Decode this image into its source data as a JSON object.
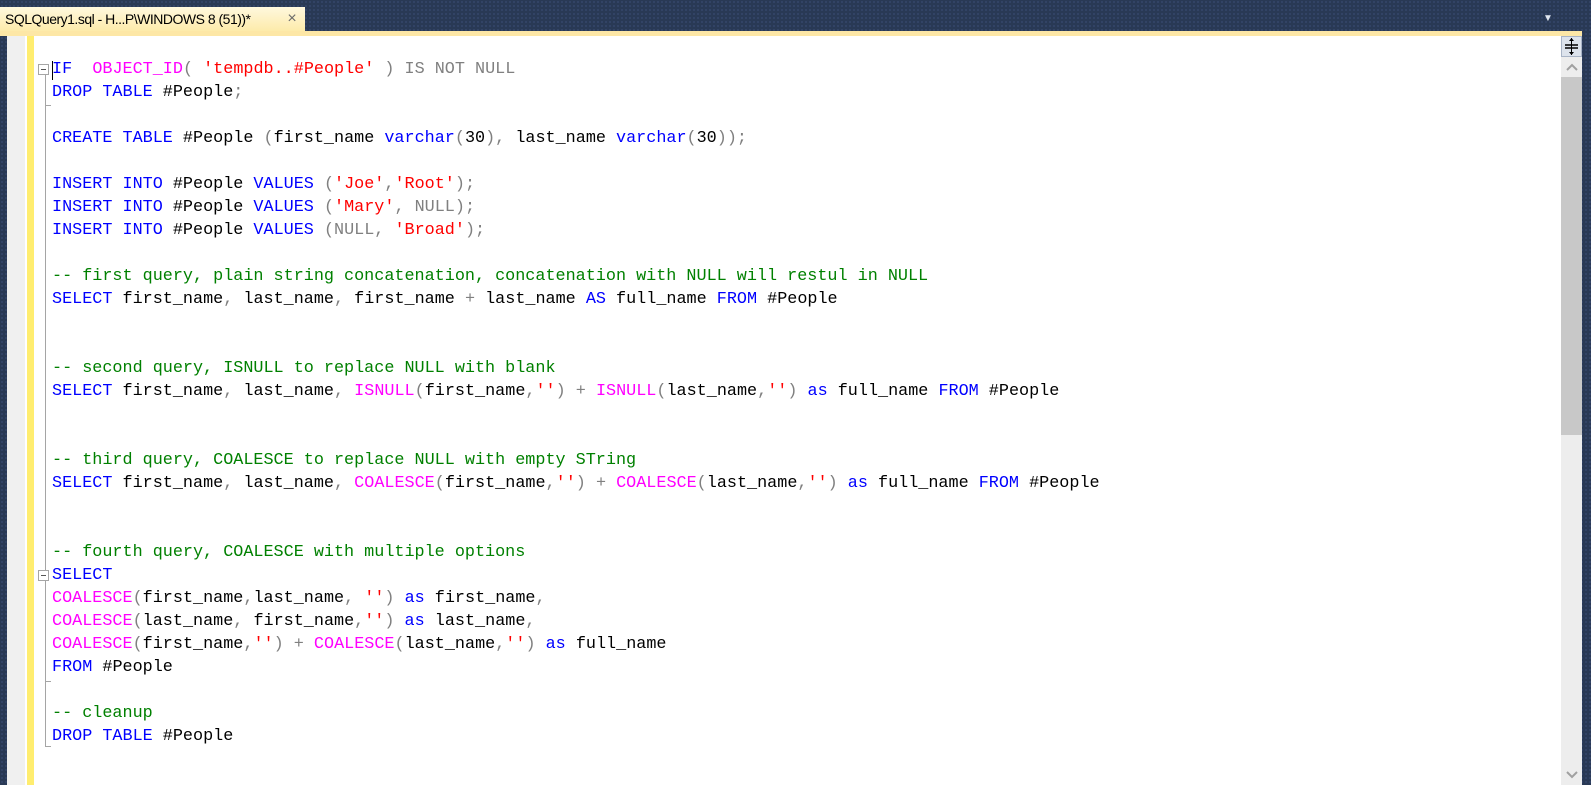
{
  "window": {
    "tab": {
      "title": "SQLQuery1.sql - H...P\\WINDOWS 8 (51))*",
      "close_icon": "×",
      "active": true
    },
    "tab_overflow_icon": "▼"
  },
  "editor": {
    "language": "T-SQL",
    "colors": {
      "keyword": "#0000ff",
      "function": "#ff00ff",
      "string": "#ff0000",
      "operator": "#808080",
      "comment": "#008000",
      "change_bar": "#ffed6f"
    },
    "lines": [
      [
        [
          "kw",
          "IF"
        ],
        [
          "",
          "  "
        ],
        [
          "fn",
          "OBJECT_ID"
        ],
        [
          "gr",
          "( "
        ],
        [
          "str",
          "'tempdb..#People'"
        ],
        [
          "gr",
          " ) IS NOT NULL"
        ]
      ],
      [
        [
          "kw",
          "DROP TABLE"
        ],
        [
          "",
          " #People"
        ],
        [
          "gr",
          ";"
        ]
      ],
      [],
      [
        [
          "kw",
          "CREATE TABLE"
        ],
        [
          "",
          " #People "
        ],
        [
          "gr",
          "("
        ],
        [
          "",
          "first_name "
        ],
        [
          "kw",
          "varchar"
        ],
        [
          "gr",
          "("
        ],
        [
          "",
          "30"
        ],
        [
          "gr",
          "),"
        ],
        [
          "",
          " last_name "
        ],
        [
          "kw",
          "varchar"
        ],
        [
          "gr",
          "("
        ],
        [
          "",
          "30"
        ],
        [
          "gr",
          "));"
        ]
      ],
      [],
      [
        [
          "kw",
          "INSERT INTO"
        ],
        [
          "",
          " #People "
        ],
        [
          "kw",
          "VALUES"
        ],
        [
          "",
          " "
        ],
        [
          "gr",
          "("
        ],
        [
          "str",
          "'Joe'"
        ],
        [
          "gr",
          ","
        ],
        [
          "str",
          "'Root'"
        ],
        [
          "gr",
          ");"
        ]
      ],
      [
        [
          "kw",
          "INSERT INTO"
        ],
        [
          "",
          " #People "
        ],
        [
          "kw",
          "VALUES"
        ],
        [
          "",
          " "
        ],
        [
          "gr",
          "("
        ],
        [
          "str",
          "'Mary'"
        ],
        [
          "gr",
          ", NULL);"
        ]
      ],
      [
        [
          "kw",
          "INSERT INTO"
        ],
        [
          "",
          " #People "
        ],
        [
          "kw",
          "VALUES"
        ],
        [
          "",
          " "
        ],
        [
          "gr",
          "(NULL, "
        ],
        [
          "str",
          "'Broad'"
        ],
        [
          "gr",
          ");"
        ]
      ],
      [],
      [
        [
          "cm",
          "-- first query, plain string concatenation, concatenation with NULL will restul in NULL"
        ]
      ],
      [
        [
          "kw",
          "SELECT"
        ],
        [
          "",
          " first_name"
        ],
        [
          "gr",
          ","
        ],
        [
          "",
          " last_name"
        ],
        [
          "gr",
          ","
        ],
        [
          "",
          " first_name "
        ],
        [
          "gr",
          "+"
        ],
        [
          "",
          " last_name "
        ],
        [
          "kw",
          "AS"
        ],
        [
          "",
          " full_name "
        ],
        [
          "kw",
          "FROM"
        ],
        [
          "",
          " #People"
        ]
      ],
      [],
      [],
      [
        [
          "cm",
          "-- second query, ISNULL to replace NULL with blank"
        ]
      ],
      [
        [
          "kw",
          "SELECT"
        ],
        [
          "",
          " first_name"
        ],
        [
          "gr",
          ","
        ],
        [
          "",
          " last_name"
        ],
        [
          "gr",
          ","
        ],
        [
          "",
          " "
        ],
        [
          "fn",
          "ISNULL"
        ],
        [
          "gr",
          "("
        ],
        [
          "",
          "first_name"
        ],
        [
          "gr",
          ","
        ],
        [
          "str",
          "''"
        ],
        [
          "gr",
          ")"
        ],
        [
          "",
          " "
        ],
        [
          "gr",
          "+"
        ],
        [
          "",
          " "
        ],
        [
          "fn",
          "ISNULL"
        ],
        [
          "gr",
          "("
        ],
        [
          "",
          "last_name"
        ],
        [
          "gr",
          ","
        ],
        [
          "str",
          "''"
        ],
        [
          "gr",
          ")"
        ],
        [
          "",
          " "
        ],
        [
          "kw",
          "as"
        ],
        [
          "",
          " full_name "
        ],
        [
          "kw",
          "FROM"
        ],
        [
          "",
          " #People"
        ]
      ],
      [],
      [],
      [
        [
          "cm",
          "-- third query, COALESCE to replace NULL with empty STring"
        ]
      ],
      [
        [
          "kw",
          "SELECT"
        ],
        [
          "",
          " first_name"
        ],
        [
          "gr",
          ","
        ],
        [
          "",
          " last_name"
        ],
        [
          "gr",
          ","
        ],
        [
          "",
          " "
        ],
        [
          "fn",
          "COALESCE"
        ],
        [
          "gr",
          "("
        ],
        [
          "",
          "first_name"
        ],
        [
          "gr",
          ","
        ],
        [
          "str",
          "''"
        ],
        [
          "gr",
          ")"
        ],
        [
          "",
          " "
        ],
        [
          "gr",
          "+"
        ],
        [
          "",
          " "
        ],
        [
          "fn",
          "COALESCE"
        ],
        [
          "gr",
          "("
        ],
        [
          "",
          "last_name"
        ],
        [
          "gr",
          ","
        ],
        [
          "str",
          "''"
        ],
        [
          "gr",
          ")"
        ],
        [
          "",
          " "
        ],
        [
          "kw",
          "as"
        ],
        [
          "",
          " full_name "
        ],
        [
          "kw",
          "FROM"
        ],
        [
          "",
          " #People"
        ]
      ],
      [],
      [],
      [
        [
          "cm",
          "-- fourth query, COALESCE with multiple options"
        ]
      ],
      [
        [
          "kw",
          "SELECT"
        ]
      ],
      [
        [
          "fn",
          "COALESCE"
        ],
        [
          "gr",
          "("
        ],
        [
          "",
          "first_name"
        ],
        [
          "gr",
          ","
        ],
        [
          "",
          "last_name"
        ],
        [
          "gr",
          ","
        ],
        [
          "",
          " "
        ],
        [
          "str",
          "''"
        ],
        [
          "gr",
          ")"
        ],
        [
          "",
          " "
        ],
        [
          "kw",
          "as"
        ],
        [
          "",
          " first_name"
        ],
        [
          "gr",
          ","
        ]
      ],
      [
        [
          "fn",
          "COALESCE"
        ],
        [
          "gr",
          "("
        ],
        [
          "",
          "last_name"
        ],
        [
          "gr",
          ","
        ],
        [
          "",
          " first_name"
        ],
        [
          "gr",
          ","
        ],
        [
          "str",
          "''"
        ],
        [
          "gr",
          ")"
        ],
        [
          "",
          " "
        ],
        [
          "kw",
          "as"
        ],
        [
          "",
          " last_name"
        ],
        [
          "gr",
          ","
        ]
      ],
      [
        [
          "fn",
          "COALESCE"
        ],
        [
          "gr",
          "("
        ],
        [
          "",
          "first_name"
        ],
        [
          "gr",
          ","
        ],
        [
          "str",
          "''"
        ],
        [
          "gr",
          ")"
        ],
        [
          "",
          " "
        ],
        [
          "gr",
          "+"
        ],
        [
          "",
          " "
        ],
        [
          "fn",
          "COALESCE"
        ],
        [
          "gr",
          "("
        ],
        [
          "",
          "last_name"
        ],
        [
          "gr",
          ","
        ],
        [
          "str",
          "''"
        ],
        [
          "gr",
          ")"
        ],
        [
          "",
          " "
        ],
        [
          "kw",
          "as"
        ],
        [
          "",
          " full_name"
        ]
      ],
      [
        [
          "kw",
          "FROM"
        ],
        [
          "",
          " #People"
        ]
      ],
      [],
      [
        [
          "cm",
          "-- cleanup"
        ]
      ],
      [
        [
          "kw",
          "DROP TABLE"
        ],
        [
          "",
          " #People"
        ]
      ]
    ]
  },
  "scrollbar": {
    "splitter_icon": "split-handle-icon",
    "scroll_up_icon": "▲",
    "scroll_down_icon": "▼",
    "thumb_start_fraction": 0.0,
    "thumb_size_fraction": 0.52
  }
}
